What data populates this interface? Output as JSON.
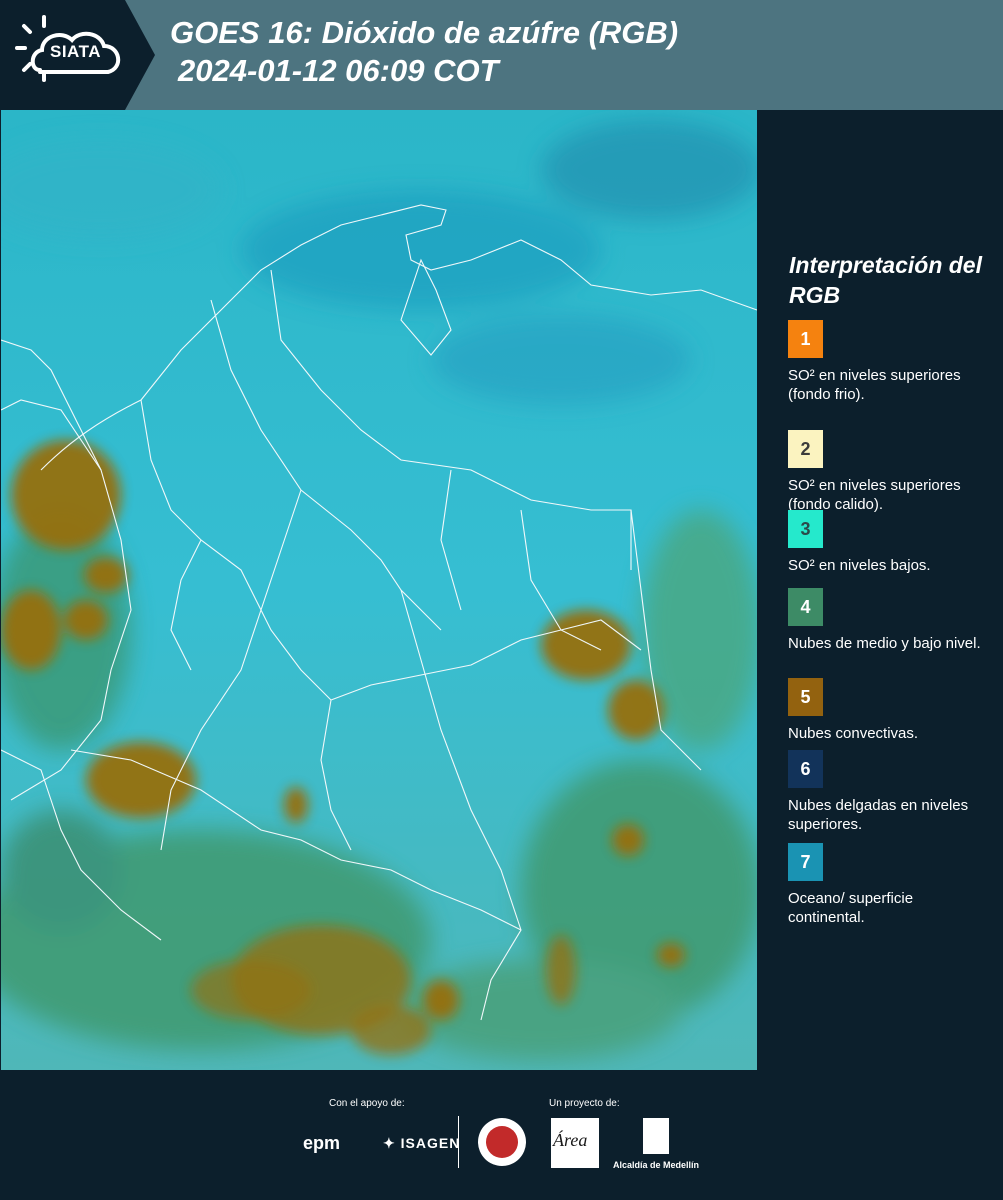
{
  "header": {
    "logo_text": "SIATA",
    "title_line1": "GOES 16: Dióxido de azúfre (RGB)",
    "title_line2": "2024-01-12 06:09 COT"
  },
  "legend": {
    "title": "Interpretación del RGB",
    "items": [
      {
        "number": "1",
        "color": "#f5820f",
        "text_color": "#ffffff",
        "label": "SO² en niveles superiores (fondo frio)."
      },
      {
        "number": "2",
        "color": "#fbf3c0",
        "text_color": "#3b3b3b",
        "label": "SO² en niveles superiores (fondo calido)."
      },
      {
        "number": "3",
        "color": "#25e9cc",
        "text_color": "#2b4a4a",
        "label": "SO² en niveles bajos."
      },
      {
        "number": "4",
        "color": "#3d8b66",
        "text_color": "#ffffff",
        "label": "Nubes de medio y bajo nivel."
      },
      {
        "number": "5",
        "color": "#93620f",
        "text_color": "#ffffff",
        "label": "Nubes convectivas."
      },
      {
        "number": "6",
        "color": "#12335a",
        "text_color": "#ffffff",
        "label": "Nubes delgadas en niveles superiores."
      },
      {
        "number": "7",
        "color": "#1a93b3",
        "text_color": "#ffffff",
        "label": "Oceano/ superficie continental."
      }
    ]
  },
  "footer": {
    "support_label": "Con el apoyo de:",
    "project_label": "Un proyecto de:",
    "sponsor_1": "epm",
    "sponsor_2": "ISAGEN",
    "partner_area": "Área",
    "partner_alcaldia": "Alcaldía de Medellín"
  }
}
